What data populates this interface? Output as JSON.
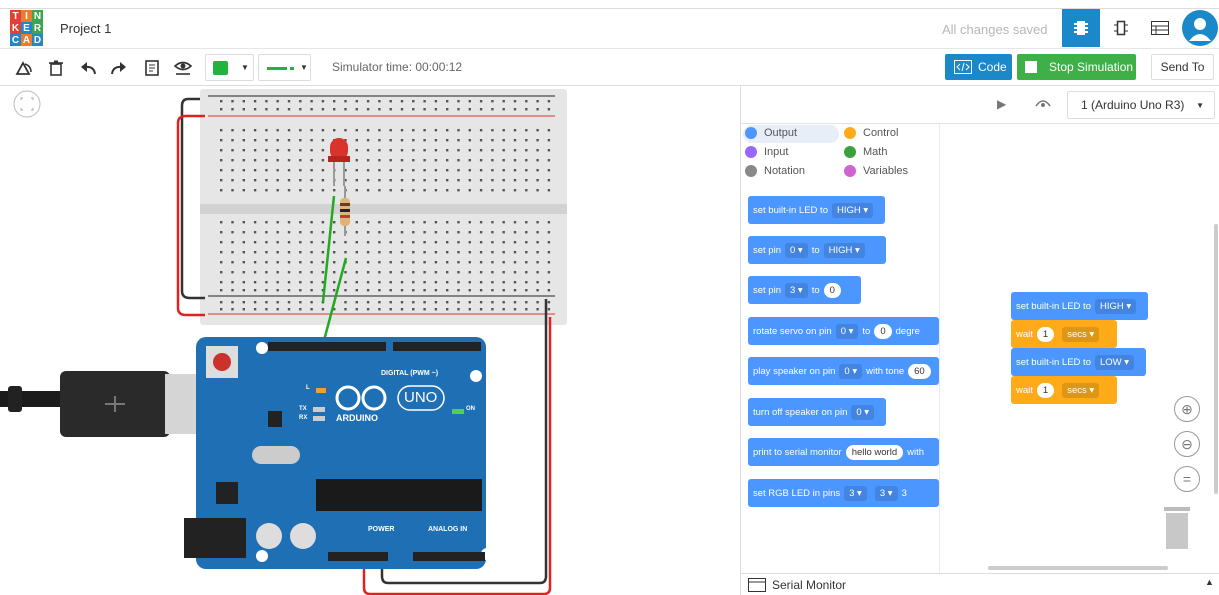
{
  "app": {
    "logo_letters": [
      "T",
      "I",
      "N",
      "K",
      "E",
      "R",
      "C",
      "A",
      "D"
    ],
    "project_title": "Project 1",
    "save_status": "All changes saved"
  },
  "toolbar": {
    "simulator_time": "Simulator time: 00:00:12",
    "code_label": "Code",
    "stop_label": "Stop Simulation",
    "send_label": "Send To"
  },
  "code_panel": {
    "device_select": "1 (Arduino Uno R3)"
  },
  "categories": [
    {
      "label": "Output",
      "color": "#4c97ff"
    },
    {
      "label": "Control",
      "color": "#ffab19"
    },
    {
      "label": "Input",
      "color": "#9966ff"
    },
    {
      "label": "Math",
      "color": "#3aa040"
    },
    {
      "label": "Notation",
      "color": "#888888"
    },
    {
      "label": "Variables",
      "color": "#cf63cf"
    }
  ],
  "palette": {
    "b1": {
      "text": "set built-in LED to",
      "dd": "HIGH"
    },
    "b2": {
      "text": "set pin",
      "dd1": "0",
      "to": "to",
      "dd2": "HIGH"
    },
    "b3": {
      "text": "set pin",
      "dd1": "3",
      "to": "to",
      "val": "0"
    },
    "b4": {
      "text": "rotate servo on pin",
      "dd1": "0",
      "to": "to",
      "val": "0",
      "tail": "degre"
    },
    "b5": {
      "text": "play speaker on pin",
      "dd1": "0",
      "with": "with tone",
      "val": "60"
    },
    "b6": {
      "text": "turn off speaker on pin",
      "dd1": "0"
    },
    "b7": {
      "text": "print to serial monitor",
      "val": "hello world",
      "tail": "with"
    },
    "b8": {
      "text": "set RGB LED in pins",
      "dd1": "3",
      "dd2": "3",
      "tail": "3"
    }
  },
  "program": {
    "s1": {
      "text": "set built-in LED to",
      "dd": "HIGH"
    },
    "s2": {
      "text": "wait",
      "val": "1",
      "dd": "secs"
    },
    "s3": {
      "text": "set built-in LED to",
      "dd": "LOW"
    },
    "s4": {
      "text": "wait",
      "val": "1",
      "dd": "secs"
    }
  },
  "serial_label": "Serial Monitor",
  "board": {
    "digital_label": "DIGITAL (PWM ~)",
    "power_label": "POWER",
    "analog_label": "ANALOG IN",
    "uno_label": "UNO",
    "brand_label": "ARDUINO",
    "on_label": "ON",
    "tx_label": "TX",
    "rx_label": "RX",
    "l_label": "L"
  },
  "colors": {
    "output": "#4c97ff",
    "control": "#ffab19",
    "accent": "#1a88c9",
    "green_btn": "#3fb048",
    "board": "#1f6fb4"
  }
}
